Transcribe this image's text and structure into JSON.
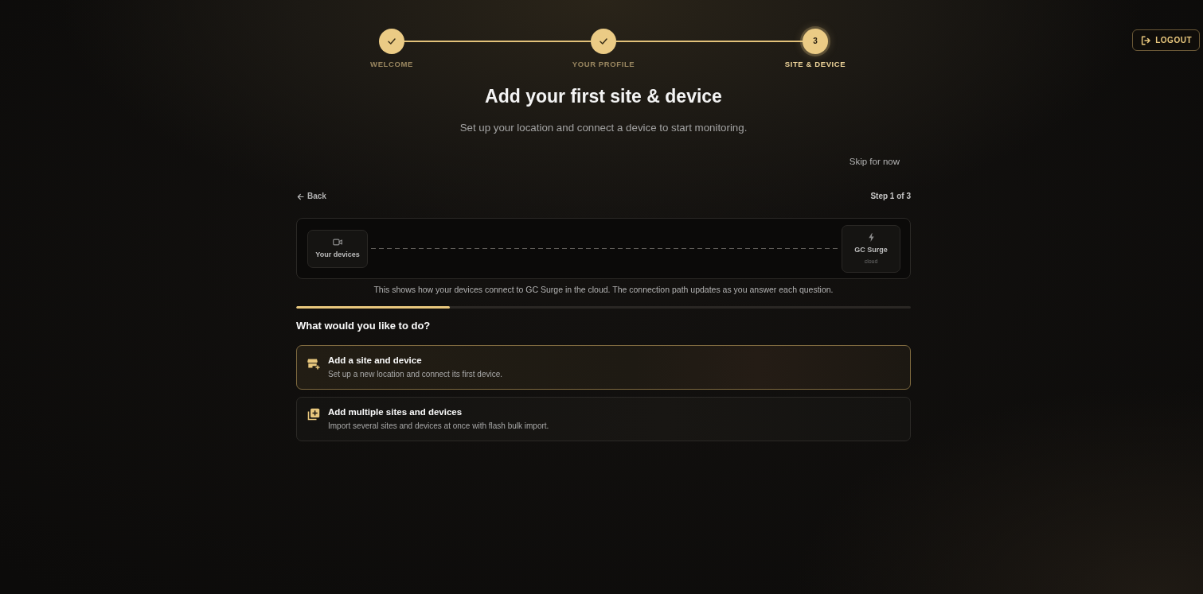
{
  "header": {
    "logout_label": "LOGOUT"
  },
  "stepper": [
    {
      "label": "WELCOME",
      "completed": true,
      "selected": false
    },
    {
      "label": "YOUR PROFILE",
      "completed": true,
      "selected": false
    },
    {
      "label": "SITE & DEVICE",
      "number": "3",
      "completed": false,
      "selected": true
    }
  ],
  "title": "Add your first site & device",
  "subtitle": "Set up your location and connect a device to start monitoring.",
  "skip_label": "Skip for now",
  "back_label": "Back",
  "step_counter": "Step 1 of 3",
  "connection_diagram": {
    "nodes": [
      {
        "kind": "devices",
        "label": "Your devices"
      },
      {
        "kind": "cloud",
        "label": "GC Surge",
        "sublabel": "cloud"
      }
    ],
    "caption": "This shows how your devices connect to GC Surge in the cloud. The connection path updates as you answer each question."
  },
  "progress": {
    "level": 0.25
  },
  "question": "What would you like to do?",
  "options": [
    {
      "kind": "single",
      "title": "Add a site and device",
      "description": "Set up a new location and connect its first device.",
      "selected": true
    },
    {
      "kind": "bulk",
      "title": "Add multiple sites and devices",
      "description": "Import several sites and devices at once with flash bulk import.",
      "selected": false
    }
  ]
}
